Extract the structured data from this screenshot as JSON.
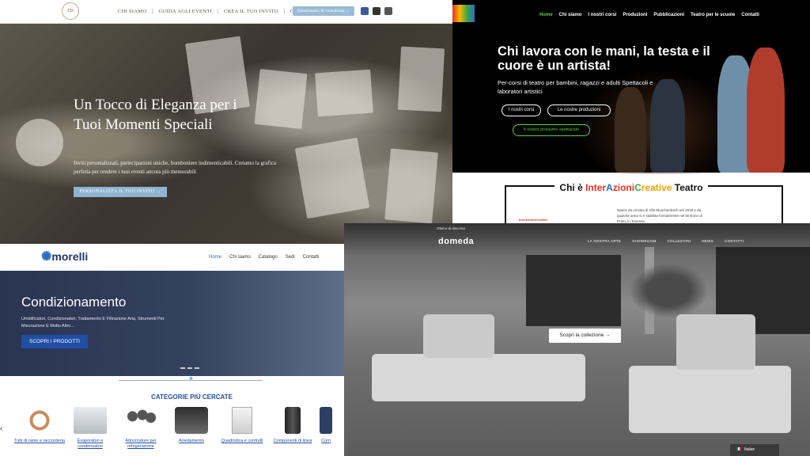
{
  "invitations": {
    "logo_text": "EB",
    "menu": [
      "CHI SIAMO",
      "GUIDA AGLI EVENTI",
      "CREA IL TUO INVITO",
      "CONTATTI"
    ],
    "quote_button": "Questionario di consulenza →",
    "hero_title": "Un Tocco di Eleganza per i Tuoi Momenti Speciali",
    "hero_sub": "Inviti personalizzati, partecipazioni uniche, bomboniere indimenticabili. Creiamo la grafica perfetta per rendere i tuoi eventi ancora più memorabili",
    "hero_cta": "PERSONALIZZA IL TUO INVITO →"
  },
  "theatre": {
    "menu": [
      "Home",
      "Chi siamo",
      "I nostri corsi",
      "Produzioni",
      "Pubblicazioni",
      "Teatro per le scuole",
      "Contatti"
    ],
    "hero_title": "Chi lavora con le mani, la testa e il cuore è un artista!",
    "hero_sub": "Per-corsi di teatro per bambini, ragazzi e adulti Spettacoli e laboratori artistici",
    "btn_courses": "I nostri corsi",
    "btn_productions": "Le nostre produzioni",
    "btn_next_show": "Il nostro prossimo spettacolo",
    "who_prefix": "Chi è ",
    "who_parts": [
      "Inter",
      "A",
      "zioni",
      "C",
      "reative",
      " Teatro"
    ],
    "desc": "Nasce da un'idea di Alfa Munchenbach nel 2018 e da qualche anno si è stabilita formalmente nel territorio di Prato, in Toscana.",
    "mini_logo": "InterAzioniCreative"
  },
  "morelli": {
    "logo": "morelli",
    "menu": [
      "Home",
      "Chi siamo",
      "Catalogo",
      "Sedi",
      "Contatti"
    ],
    "hero_title": "Condizionamento",
    "hero_sub": "Umidificatori, Condizionatori, Trattamento E Filtrazione Aria, Strumenti Per Misurazione E Molto Altro...",
    "hero_cta": "SCOPRI I PRODOTTI",
    "categories_title": "CATEGORIE PIÙ CERCATE",
    "categories": [
      "Tubi di rame e raccorderia",
      "Evaporatori e condensatori",
      "Attrezzature per refrigerazione",
      "Arredamento",
      "Quadristica e controlli",
      "Componenti di linea",
      "Com"
    ],
    "nav_arrow": "‹"
  },
  "domeda": {
    "tagline": "Ottimo di discorso",
    "logo": "domeda",
    "menu": [
      "LA NOSTRA ARTE",
      "SHOWROOM",
      "COLLEZIONI",
      "NEWS",
      "CONTATTI"
    ],
    "cta": "Scopri la collezione →",
    "language": "Italian"
  },
  "colors": {
    "invite_accent": "#9bbbd6",
    "theatre_green": "#5fcf3d",
    "morelli_blue": "#1f4ea3"
  }
}
